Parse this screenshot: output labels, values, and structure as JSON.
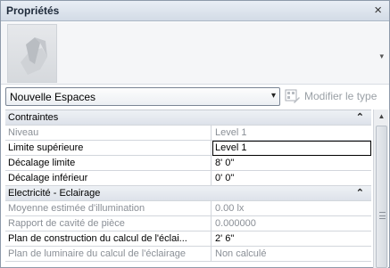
{
  "panel": {
    "title": "Propriétés",
    "close_glyph": "×"
  },
  "type_selector": {
    "selected": "Nouvelle Espaces",
    "arrow_glyph": "▾",
    "thumb_arrow_glyph": "▾",
    "edit_type_label": "Modifier le type",
    "edit_type_icon": "edit-type-icon"
  },
  "sections": {
    "constraints": {
      "label": "Contraintes",
      "collapse_glyph": "⌃"
    },
    "electrical": {
      "label": "Electricité - Eclairage",
      "collapse_glyph": "⌃"
    }
  },
  "properties": {
    "niveau": {
      "name": "Niveau",
      "value": "Level 1"
    },
    "limite_sup": {
      "name": "Limite supérieure",
      "value": "Level 1"
    },
    "decalage_lim": {
      "name": "Décalage limite",
      "value": "8'  0\""
    },
    "decalage_inf": {
      "name": "Décalage inférieur",
      "value": "0'  0\""
    },
    "moyenne": {
      "name": "Moyenne estimée d'illumination",
      "value": "0.00 lx"
    },
    "rapport": {
      "name": "Rapport de cavité de pièce",
      "value": "0.000000"
    },
    "plan_construction": {
      "name": "Plan de construction du calcul de l'éclai...",
      "value": "2'  6\""
    },
    "plan_luminaire": {
      "name": "Plan de luminaire du calcul de l'éclairage",
      "value": "Non calculé"
    }
  },
  "scrollbar": {
    "up_glyph": "▲"
  }
}
